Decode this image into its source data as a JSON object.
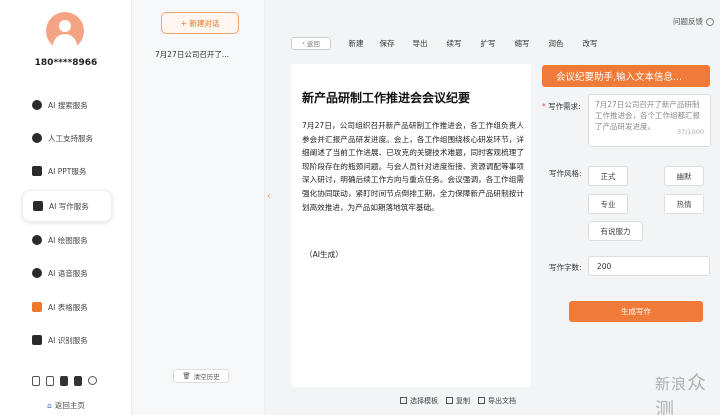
{
  "user": {
    "phone": "180****8966"
  },
  "nav": {
    "items": [
      {
        "label": "AI 搜索服务",
        "icon": "search-icon"
      },
      {
        "label": "人工支持服务",
        "icon": "support-agent-icon"
      },
      {
        "label": "AI PPT服务",
        "icon": "ppt-icon"
      },
      {
        "label": "AI 写作服务",
        "icon": "write-icon"
      },
      {
        "label": "AI 绘图服务",
        "icon": "paint-icon"
      },
      {
        "label": "AI 语音服务",
        "icon": "microphone-icon"
      },
      {
        "label": "AI 表格服务",
        "icon": "table-icon"
      },
      {
        "label": "AI 识别服务",
        "icon": "scan-icon"
      }
    ],
    "active_index": 3,
    "home_label": "返回主页"
  },
  "history": {
    "new_chat_label": "+ 新建对话",
    "items": [
      "7月27日公司召开了..."
    ],
    "clear_label": "清空历史"
  },
  "header": {
    "feedback_label": "问题反馈"
  },
  "toolbar": {
    "back_label": "返回",
    "tools": [
      "新建",
      "保存",
      "导出",
      "续写",
      "扩写",
      "缩写",
      "润色",
      "改写"
    ]
  },
  "document": {
    "title": "新产品研制工作推进会会议纪要",
    "body": "7月27日，公司组织召开新产品研制工作推进会，各工作组负责人参会并汇报产品研发进度。会上，各工作组围绕核心研发环节，详细阐述了当前工作进展、已攻克的关键技术难题，同时客观梳理了现阶段存在的瓶颈问题。与会人员针对进度衔接、资源调配等事项深入研讨，明确后续工作方向与重点任务。会议强调，各工作组需强化协同联动，紧盯时间节点倒排工期，全力保障新产品研制按计划高效推进，为产品如期落地筑牢基础。",
    "note": "（AI生成）",
    "actions": [
      "选择模板",
      "复制",
      "导出文档"
    ]
  },
  "form": {
    "banner": "会议纪要助手,输入文本信息...",
    "requirement_label": "写作需求:",
    "requirement_value": "7月27日公司召开了新产品研制工作推进会，各个工作组都汇报了产品研发进度。",
    "requirement_count": "37/1000",
    "style_label": "写作风格:",
    "styles": [
      "正式",
      "幽默",
      "专业",
      "热情",
      "有说服力"
    ],
    "wordcount_label": "写作字数:",
    "wordcount_value": "200",
    "generate_label": "生成写作"
  },
  "watermark": {
    "text1": "新",
    "text2": "浪",
    "text3": "众测"
  }
}
